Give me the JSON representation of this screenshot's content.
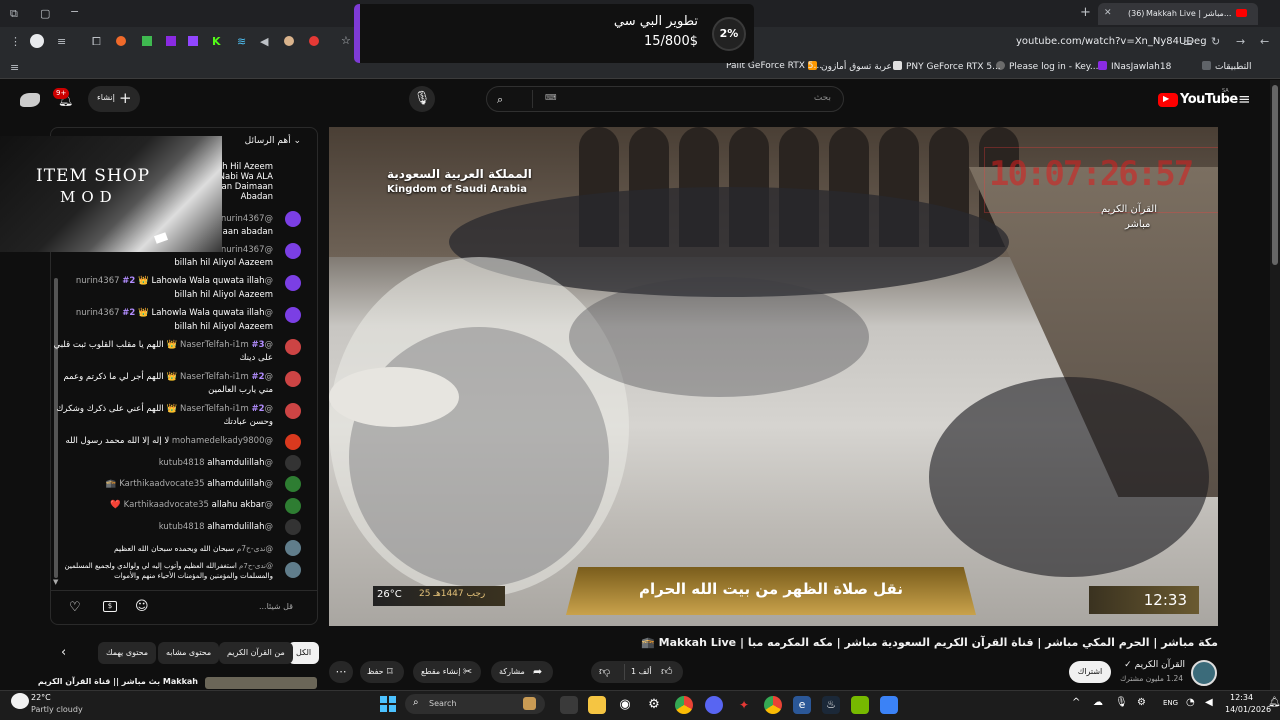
{
  "browser": {
    "tab_title": "Makkah Live | مباشر...",
    "tab_count": "(36)",
    "url": "youtube.com/watch?v=Xn_Ny84UDeg",
    "bookmarks": [
      {
        "label": "التطبيقات",
        "color": "#5f6368"
      },
      {
        "label": "INasJawlah18",
        "color": "#8a2be2"
      },
      {
        "label": "Please log in - Key...",
        "color": "#6b6b6b"
      },
      {
        "label": "PNY GeForce RTX 5...",
        "color": "#e0e0e0"
      },
      {
        "label": "عربة تسوق أمازون",
        "color": "#ff9900"
      },
      {
        "label": "Palit GeForce RTX 5...",
        "color": "#76b900"
      }
    ]
  },
  "popup": {
    "percent": "2%",
    "title": "تطوير البي سي",
    "amount": "15/800$"
  },
  "youtube": {
    "logo": "YouTube",
    "region": "SA",
    "search_placeholder": "بحث",
    "create_label": "إنشاء",
    "notif_count": "9+"
  },
  "chat": {
    "header": "أهم الرسائل",
    "input_placeholder": "قل شيئا...",
    "overlay_line1": "ITEM SHOP",
    "overlay_line2": "MOD",
    "top_fragment": [
      "h Hil Azeem.",
      "Nabi Wa ALA",
      "ran Daimaan",
      "Abadan",
      "iiaan abadan"
    ],
    "messages": [
      {
        "author": "@nurin4367",
        "text": "",
        "badge": "",
        "color": "#7b3fe4"
      },
      {
        "author": "@nurin4367",
        "text": "billah hil Aliyol Aazeem",
        "badge": "",
        "color": "#7b3fe4"
      },
      {
        "author": "@nurin4367",
        "text": "Lahowla Wala quwata illah",
        "text2": "billah hil Aliyol Aazeem",
        "badge": "#2 👑",
        "color": "#7b3fe4"
      },
      {
        "author": "@nurin4367",
        "text": "Lahowla Wala quwata illah",
        "text2": "billah hil Aliyol Aazeem",
        "badge": "#2 👑",
        "color": "#7b3fe4"
      },
      {
        "author": "@NaserTelfah-i1m",
        "text": "اللهم يا مقلب القلوب ثبت قلبي",
        "text2": "على دينك",
        "badge": "#3 👑",
        "color": "#c44"
      },
      {
        "author": "@NaserTelfah-i1m",
        "text": "اللهم أجر لي ما ذكرتم وعمم",
        "text2": "مني يارب العالمين",
        "badge": "#2 👑",
        "color": "#c44"
      },
      {
        "author": "@NaserTelfah-i1m",
        "text": "اللهم أعني على ذكرك وشكرك",
        "text2": "وحسن عبادتك",
        "badge": "#2 👑",
        "color": "#c44"
      },
      {
        "author": "@mohamedelkady9800",
        "text": "لا إله إلا الله محمد رسول الله",
        "badge": "",
        "color": "#d9391e"
      },
      {
        "author": "@kutub4818",
        "text": "alhamdulillah",
        "badge": "",
        "color": "#333"
      },
      {
        "author": "@Karthikaadvocate35",
        "text": "alhamdulillah 🕋",
        "badge": "",
        "color": "#2e7d32"
      },
      {
        "author": "@Karthikaadvocate35",
        "text": "allahu akbar ❤️",
        "badge": "",
        "color": "#2e7d32"
      },
      {
        "author": "@kutub4818",
        "text": "alhamdulillah",
        "badge": "",
        "color": "#333"
      },
      {
        "author": "@ندى-ح7م",
        "text": "سبحان الله وبحمده سبحان الله العظيم",
        "badge": "",
        "color": "#607d8b"
      },
      {
        "author": "@ندى-ح7م",
        "text": "استغفرالله العظيم وأتوب إليه لي ولوالدي ولجميع المسلمين",
        "text2": "والمسلمات والمؤمنين والمؤمنات الأحياء منهم والأموات",
        "badge": "",
        "color": "#607d8b"
      }
    ]
  },
  "video": {
    "channel_ar": "المملكة العربية السعودية",
    "channel_en": "Kingdom of Saudi Arabia",
    "clock": "10:07:26:57",
    "quran_label": "القرآن الكريم",
    "live_label": "مباشر",
    "temperature": "26°C",
    "hijri_date": "25 رجب 1447هـ",
    "caption": "نقل صلاة الظهر من بيت الله الحرام",
    "time": "12:33"
  },
  "below": {
    "title": "مكة مباشر | الحرم المكي مباشر | قناة القرآن الكريم السعودية مباشر | مكه المكرمه مبا | Makkah Live 🕋",
    "channel_name": "القرآن الكريم",
    "subscribers": "1.24 مليون مشترك",
    "subscribe_label": "اشتراك",
    "like_count": "1 ألف",
    "share_label": "مشاركة",
    "clip_label": "إنشاء مقطع",
    "save_label": "حفظ",
    "chips": [
      "الكل",
      "من القرآن الكريم",
      "محتوى مشابه",
      "محتوى يهمك"
    ],
    "next_video": "بث مباشر || قناة القرآن الكريم Makkah"
  },
  "taskbar": {
    "temp": "22°C",
    "weather": "Partly cloudy",
    "search_label": "Search",
    "time": "12:34",
    "date": "14/01/2026",
    "lang": "ENG"
  }
}
